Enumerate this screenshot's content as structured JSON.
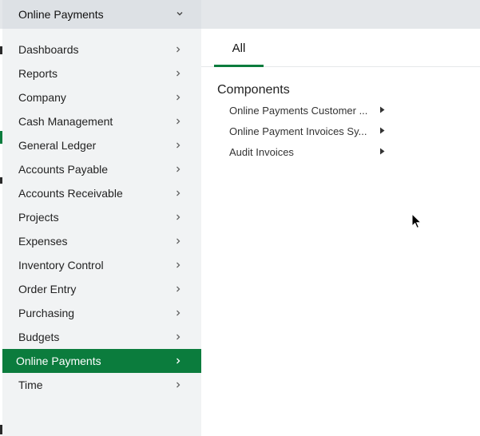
{
  "top_menu": {
    "label": "Online Payments",
    "icon": "chevron-down-icon"
  },
  "sidebar": {
    "active_index": 13,
    "active_color": "#0b7c3d",
    "items": [
      {
        "label": "Dashboards"
      },
      {
        "label": "Reports"
      },
      {
        "label": "Company"
      },
      {
        "label": "Cash Management"
      },
      {
        "label": "General Ledger"
      },
      {
        "label": "Accounts Payable"
      },
      {
        "label": "Accounts Receivable"
      },
      {
        "label": "Projects"
      },
      {
        "label": "Expenses"
      },
      {
        "label": "Inventory Control"
      },
      {
        "label": "Order Entry"
      },
      {
        "label": "Purchasing"
      },
      {
        "label": "Budgets"
      },
      {
        "label": "Online Payments"
      },
      {
        "label": "Time"
      }
    ]
  },
  "panel": {
    "tab_label": "All",
    "section_title": "Components",
    "components": [
      {
        "label": "Online Payments Customer ..."
      },
      {
        "label": "Online Payment Invoices Sy..."
      },
      {
        "label": "Audit Invoices"
      }
    ]
  }
}
